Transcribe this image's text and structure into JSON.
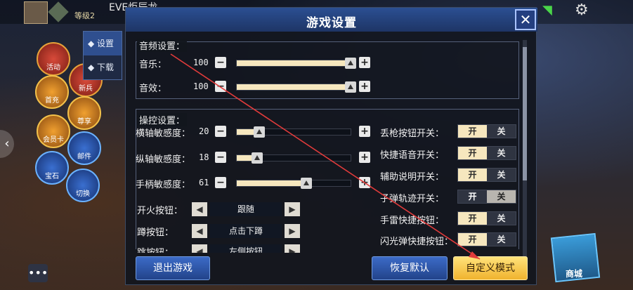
{
  "header": {
    "level_text": "等级2",
    "player_name": "EVE炬辰龙"
  },
  "side_menu": {
    "tabs": [
      {
        "label": "设置",
        "active": true
      },
      {
        "label": "下载",
        "active": false
      }
    ],
    "buttons": [
      {
        "label": "活动"
      },
      {
        "label": "新兵"
      },
      {
        "label": "首充"
      },
      {
        "label": "尊享"
      },
      {
        "label": "会员卡"
      },
      {
        "label": "邮件"
      },
      {
        "label": "宝石"
      },
      {
        "label": "切换"
      }
    ]
  },
  "shop": {
    "label": "商城"
  },
  "dialog": {
    "title": "游戏设置",
    "close_icon": "close-icon",
    "audio": {
      "title": "音频设置：",
      "rows": [
        {
          "label": "音乐：",
          "value": "100",
          "level": 1.0
        },
        {
          "label": "音效：",
          "value": "100",
          "level": 1.0
        }
      ]
    },
    "controls": {
      "title": "操控设置：",
      "sliders": [
        {
          "label": "横轴敏感度：",
          "value": "20",
          "level": 0.2
        },
        {
          "label": "纵轴敏感度：",
          "value": "18",
          "level": 0.18
        },
        {
          "label": "手柄敏感度：",
          "value": "61",
          "level": 0.61
        }
      ],
      "selectors": [
        {
          "label": "开火按钮：",
          "value": "跟随"
        },
        {
          "label": "蹲按钮：",
          "value": "点击下蹲"
        },
        {
          "label": "跳按钮：",
          "value": "左侧按钮"
        }
      ],
      "toggles": [
        {
          "label": "丢枪按钮开关：",
          "on": true
        },
        {
          "label": "快捷语音开关：",
          "on": true
        },
        {
          "label": "辅助说明开关：",
          "on": true
        },
        {
          "label": "子弹轨迹开关：",
          "on": false
        },
        {
          "label": "手雷快捷按钮：",
          "on": true
        },
        {
          "label": "闪光弹快捷按钮：",
          "on": true
        }
      ],
      "toggle_on_label": "开",
      "toggle_off_label": "关"
    },
    "footer": {
      "exit_label": "退出游戏",
      "restore_label": "恢复默认",
      "custom_label": "自定义模式"
    }
  },
  "colors": {
    "header_blue": "#2b4f92",
    "slider_fill": "#f6e7be",
    "accent_yellow": "#f0b32e",
    "annotation_red": "#e23b3b"
  }
}
